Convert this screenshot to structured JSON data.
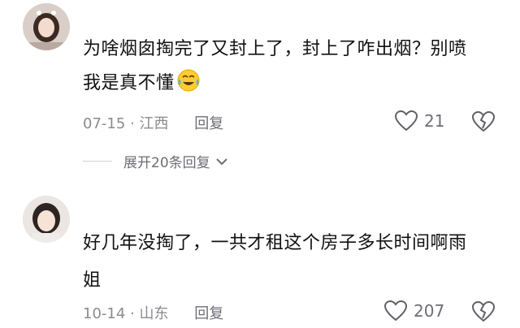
{
  "comments": [
    {
      "text_line1": "为啥烟囱掏完了又封上了，封上了咋出烟？别喷",
      "text_line2": "我是真不懂",
      "date": "07-15",
      "location": "江西",
      "reply_label": "回复",
      "likes": "21"
    },
    {
      "text_line1": "好几年没掏了，一共才租这个房子多长时间啊雨",
      "text_line2": "姐",
      "date": "10-14",
      "location": "山东",
      "reply_label": "回复",
      "likes": "207"
    }
  ],
  "expand_replies": {
    "label": "展开20条回复"
  },
  "separator": "·"
}
